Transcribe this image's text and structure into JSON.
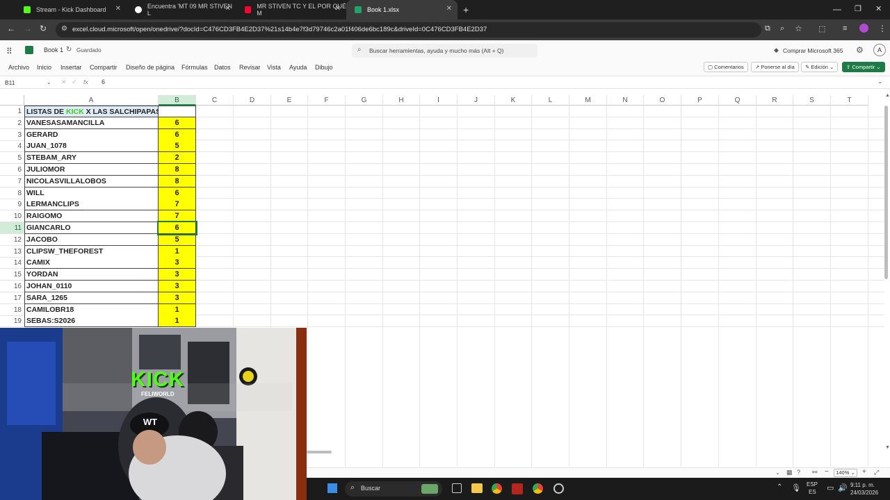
{
  "browser": {
    "tabs": [
      {
        "title": "Stream - Kick Dashboard",
        "color": "#53fc18"
      },
      {
        "title": "Encuentra 'MT 09 MR STIVEN L",
        "color": "#111111"
      },
      {
        "title": "MR STIVEN TC Y EL POR QUÉ M",
        "color": "#ff0033"
      },
      {
        "title": "Book 1.xlsx",
        "color": "#21a366"
      }
    ],
    "url": "excel.cloud.microsoft/open/onedrive/?docId=C476CD3FB4E2D37%21s14b4e7f3d79746c2a01f406de6bc189c&driveId=0C476CD3FB4E2D37"
  },
  "app": {
    "file_name": "Book 1",
    "save_status": "Guardado",
    "search_placeholder": "Buscar herramientas, ayuda y mucho más (Alt + Q)",
    "buy_label": "Comprar Microsoft 365",
    "avatar": "A"
  },
  "ribbon": {
    "menus": [
      "Archivo",
      "Inicio",
      "Insertar",
      "Compartir",
      "Diseño de página",
      "Fórmulas",
      "Datos",
      "Revisar",
      "Vista",
      "Ayuda",
      "Dibujo"
    ],
    "comments": "Comentarios",
    "catch_up": "Ponerse al día",
    "editing": "Edición",
    "share": "Compartir"
  },
  "formula_bar": {
    "cell_ref": "B11",
    "value": "6",
    "fx": "fx"
  },
  "sheet": {
    "columns": [
      "A",
      "B",
      "C",
      "D",
      "E",
      "F",
      "G",
      "H",
      "I",
      "J",
      "K",
      "L",
      "M",
      "N",
      "O",
      "P",
      "Q",
      "R",
      "S",
      "T"
    ],
    "title_prefix": "LISTAS DE ",
    "title_kick": "KICK",
    "title_suffix": " X LAS SALCHIPAPAS:",
    "rows": [
      {
        "n": "1",
        "name": "",
        "value": ""
      },
      {
        "n": "2",
        "name": "VANESASAMANCILLA",
        "value": "6"
      },
      {
        "n": "3",
        "name": "GERARD",
        "value": "6"
      },
      {
        "n": "4",
        "name": "JUAN_1078",
        "value": "5"
      },
      {
        "n": "5",
        "name": "STEBAM_ARY",
        "value": "2"
      },
      {
        "n": "6",
        "name": "JULIOMOR",
        "value": "8"
      },
      {
        "n": "7",
        "name": "NICOLASVILLALOBOS",
        "value": "8"
      },
      {
        "n": "8",
        "name": "WILL",
        "value": "6"
      },
      {
        "n": "9",
        "name": "LERMANCLIPS",
        "value": "7"
      },
      {
        "n": "10",
        "name": "RAIGOMO",
        "value": "7"
      },
      {
        "n": "11",
        "name": "GIANCARLO",
        "value": "6"
      },
      {
        "n": "12",
        "name": "JACOBO",
        "value": "5"
      },
      {
        "n": "13",
        "name": "CLIPSW_THEFOREST",
        "value": "1"
      },
      {
        "n": "14",
        "name": "CAMIX",
        "value": "3"
      },
      {
        "n": "15",
        "name": "YORDAN",
        "value": "3"
      },
      {
        "n": "16",
        "name": "JOHAN_0110",
        "value": "3"
      },
      {
        "n": "17",
        "name": "SARA_1265",
        "value": "3"
      },
      {
        "n": "18",
        "name": "CAMILOBR18",
        "value": "1"
      },
      {
        "n": "19",
        "name": "SEBAS:S2026",
        "value": "1"
      }
    ]
  },
  "status": {
    "zoom": "140%"
  },
  "webcam": {
    "logo": "KICK",
    "sub": "FELIWORLD"
  },
  "taskbar": {
    "search": "Buscar",
    "lang1": "ESP",
    "lang2": "ES",
    "time": "9:11 p. m.",
    "date": "24/03/2026"
  }
}
